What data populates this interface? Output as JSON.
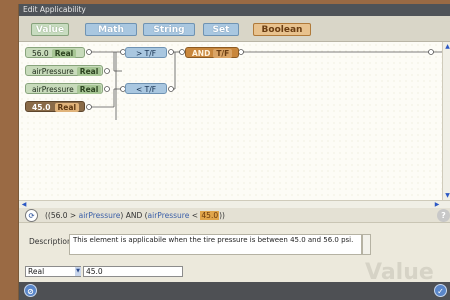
{
  "window": {
    "title": "Edit Applicability"
  },
  "palette": {
    "items": [
      {
        "label": "Value"
      },
      {
        "label": "Math"
      },
      {
        "label": "String"
      },
      {
        "label": "Set"
      },
      {
        "label": "Boolean"
      }
    ]
  },
  "canvas": {
    "blocks": {
      "num_value": "56.0",
      "num_type": "Real",
      "var1": "airPressure",
      "var1_type": "Real",
      "var2": "airPressure",
      "var2_type": "Real",
      "num2_value": "45.0",
      "num2_type": "Real",
      "gt_label": "> T/F",
      "lt_label": "< T/F",
      "and_label": "AND",
      "and_type": "T/F"
    }
  },
  "expression": {
    "prefix": "((56.0 > ",
    "var1": "airPressure",
    "mid": ") AND (",
    "var2": "airPressure",
    "lt": " < ",
    "highlight": "45.0",
    "suffix": "))"
  },
  "description": {
    "label": "Description",
    "text": "This element is applicabile when the tire pressure is between 45.0 and 56.0 psi."
  },
  "value_editor": {
    "type_selected": "Real",
    "value": "45.0",
    "watermark": "Value"
  },
  "colors": {
    "accent_blue": "#a9c7e0",
    "accent_green": "#c8dbbb",
    "accent_orange": "#c9873c",
    "highlight": "#e0a54a"
  }
}
